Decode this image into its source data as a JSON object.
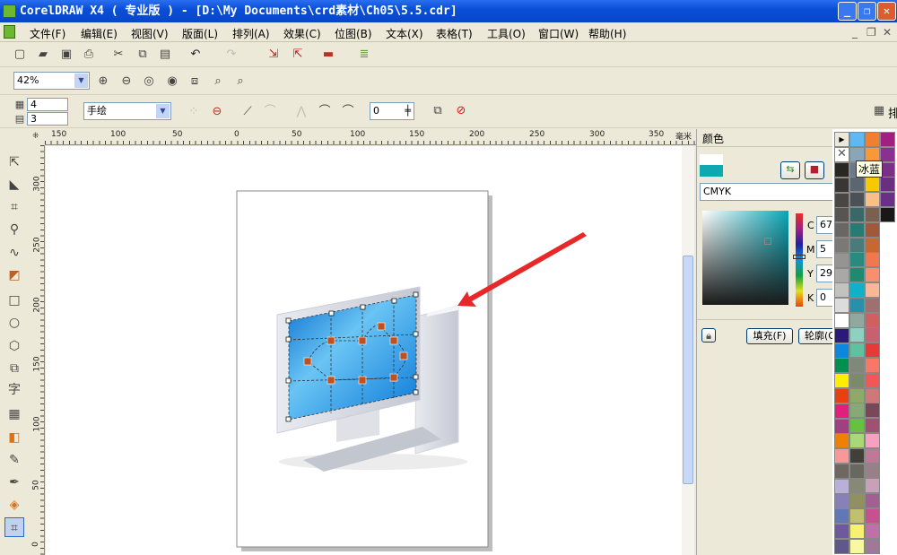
{
  "window": {
    "title": "CorelDRAW X4 ( 专业版 ) - [D:\\My Documents\\crd素材\\Ch05\\5.5.cdr]",
    "min": "_",
    "max": "❐",
    "close": "✕"
  },
  "menu": [
    "文件(F)",
    "编辑(E)",
    "视图(V)",
    "版面(L)",
    "排列(A)",
    "效果(C)",
    "位图(B)",
    "文本(X)",
    "表格(T)",
    "工具(O)",
    "窗口(W)",
    "帮助(H)"
  ],
  "doc_controls": {
    "min": "_",
    "restore": "❐",
    "close": "✕"
  },
  "standard_toolbar": {
    "icons": [
      "new-icon",
      "open-icon",
      "save-icon",
      "print-icon",
      "cut-icon",
      "copy-icon",
      "paste-icon",
      "undo-icon",
      "redo-icon",
      "import-icon",
      "export-icon",
      "application-launcher-icon",
      "welcome-screen-icon"
    ]
  },
  "zoom_toolbar": {
    "zoom_level": "42%",
    "icons": [
      "zoom-in-icon",
      "zoom-out-icon",
      "zoom-selected-icon",
      "zoom-all-icon",
      "zoom-page-icon",
      "zoom-width-icon",
      "zoom-height-icon"
    ]
  },
  "property_bar": {
    "columns": "4",
    "rows": "3",
    "mode": "手绘",
    "nudge": "0",
    "right_label": "排"
  },
  "rulers": {
    "top": [
      "150",
      "100",
      "50",
      "0",
      "50",
      "100",
      "150",
      "200",
      "250",
      "300",
      "350"
    ],
    "unit": "毫米",
    "left": [
      "300",
      "250",
      "200",
      "150",
      "100",
      "50",
      "0"
    ]
  },
  "tools": [
    "pick-tool",
    "shape-tool",
    "crop-tool",
    "zoom-tool",
    "freehand-tool",
    "smart-fill-tool",
    "rectangle-tool",
    "ellipse-tool",
    "polygon-tool",
    "basic-shapes-tool",
    "text-tool",
    "table-tool",
    "interactive-blend-tool",
    "eyedropper-tool",
    "outline-tool",
    "fill-tool",
    "interactive-fill-tool"
  ],
  "text_tool_glyph": "字",
  "docker": {
    "title": "颜色",
    "model": "CMYK",
    "c_label": "C",
    "c": "67",
    "m_label": "M",
    "m": "5",
    "y_label": "Y",
    "y": "29",
    "k_label": "K",
    "k": "0",
    "fill_button": "填充(F)",
    "outline_button": "轮廓(O)",
    "current_color": "#10a8b0"
  },
  "palette": {
    "tooltip": "冰蓝",
    "col1": [
      "#2a2622",
      "#3a3634",
      "#4a4644",
      "#585452",
      "#6a6664",
      "#7c7876",
      "#969492",
      "#aaa8a6",
      "#c4c2c0",
      "#dcdcdc",
      "#ffffff",
      "#2c1a7a",
      "#0a88e0",
      "#009050",
      "#ffee00",
      "#e84010",
      "#e0207a",
      "#a04080",
      "#f08000",
      "#f89898",
      "#706860",
      "#b8b0d8",
      "#8880b8",
      "#6078b8",
      "#7058a0",
      "#605888"
    ],
    "col2": [
      "#60b8f0",
      "#8aa4b8",
      "#6a7a88",
      "#5a6670",
      "#4a5258",
      "#3a6868",
      "#2a7a74",
      "#4a7a7a",
      "#2a8a80",
      "#208a70",
      "#10b0c8",
      "#2890a8",
      "#90a8a0",
      "#90d0c0",
      "#60c0a0",
      "#80887a",
      "#7a8a6a",
      "#90a868",
      "#88a878",
      "#68c040",
      "#a8d878",
      "#404038",
      "#686860",
      "#888878",
      "#909060",
      "#c0c070",
      "#f8f070",
      "#f8f8a0"
    ],
    "col3": [
      "#f08030",
      "#f89838",
      "#f8a020",
      "#f8c800",
      "#f8c088",
      "#7a6050",
      "#a05838",
      "#c86830",
      "#f07850",
      "#f89070",
      "#f8b898",
      "#a07070",
      "#d06060",
      "#c86070",
      "#e83838",
      "#f87868",
      "#f05858",
      "#d07878",
      "#784858",
      "#a05070",
      "#f8a0c0",
      "#c07898",
      "#988088",
      "#c8a0b8",
      "#a06090",
      "#c85090",
      "#c070a8",
      "#a07898"
    ],
    "col4": [
      "#a02080",
      "#8a3090",
      "#7a3088",
      "#6a3080",
      "#6a3088",
      "#181818"
    ]
  },
  "colors": {
    "title_bar": "#0a4fd8",
    "arrow": "#e82828",
    "screen": "#1e90e0",
    "node": "#c05020"
  }
}
